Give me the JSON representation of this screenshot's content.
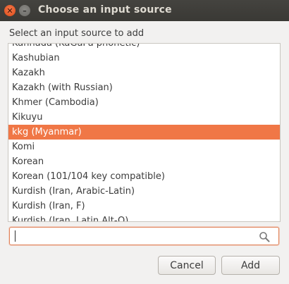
{
  "window": {
    "title": "Choose an input source",
    "close_glyph": "✕",
    "minimize_glyph": "–"
  },
  "prompt": "Select an input source to add",
  "sources": [
    "Kannada (KaGaPa phonetic)",
    "Kashubian",
    "Kazakh",
    "Kazakh (with Russian)",
    "Khmer (Cambodia)",
    "Kikuyu",
    "kkg (Myanmar)",
    "Komi",
    "Korean",
    "Korean (101/104 key compatible)",
    "Kurdish (Iran, Arabic-Latin)",
    "Kurdish (Iran, F)",
    "Kurdish (Iran, Latin Alt-Q)"
  ],
  "selected_source": "kkg (Myanmar)",
  "search": {
    "value": "",
    "placeholder": "",
    "icon": "search-icon"
  },
  "buttons": {
    "cancel": "Cancel",
    "add": "Add"
  },
  "colors": {
    "accent": "#f07746",
    "titlebar": "#3c3b37",
    "close": "#e9541f"
  }
}
